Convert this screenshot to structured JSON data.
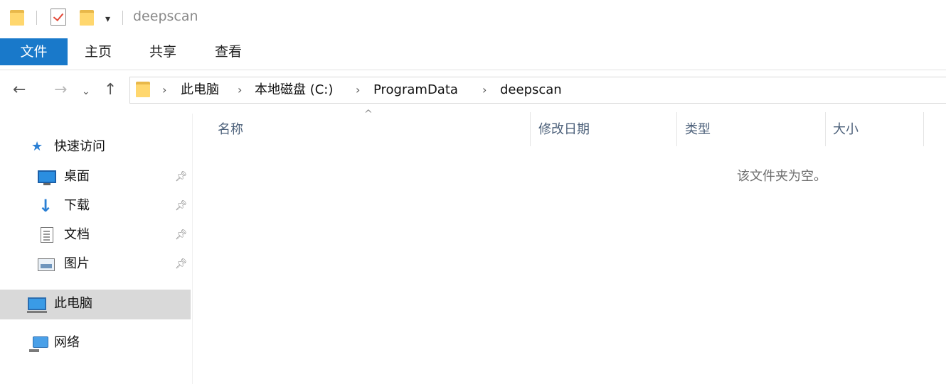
{
  "window": {
    "title": "deepscan"
  },
  "ribbon": {
    "tabs": [
      {
        "label": "文件",
        "active": true
      },
      {
        "label": "主页"
      },
      {
        "label": "共享"
      },
      {
        "label": "查看"
      }
    ]
  },
  "address_bar": {
    "breadcrumbs": [
      "此电脑",
      "本地磁盘 (C:)",
      "ProgramData",
      "deepscan"
    ]
  },
  "sidebar": {
    "quick_access": {
      "label": "快速访问",
      "icon": "star-icon"
    },
    "pinned": [
      {
        "label": "桌面",
        "icon": "desktop-icon"
      },
      {
        "label": "下载",
        "icon": "download-icon"
      },
      {
        "label": "文档",
        "icon": "documents-icon"
      },
      {
        "label": "图片",
        "icon": "pictures-icon"
      }
    ],
    "this_pc": {
      "label": "此电脑",
      "icon": "computer-icon",
      "selected": true
    },
    "network": {
      "label": "网络",
      "icon": "network-icon"
    }
  },
  "columns": [
    "名称",
    "修改日期",
    "类型",
    "大小"
  ],
  "content": {
    "empty_message": "该文件夹为空。"
  },
  "colors": {
    "accent": "#1979ca",
    "selected_bg": "#d9d9d9",
    "header_text": "#4c607a"
  }
}
